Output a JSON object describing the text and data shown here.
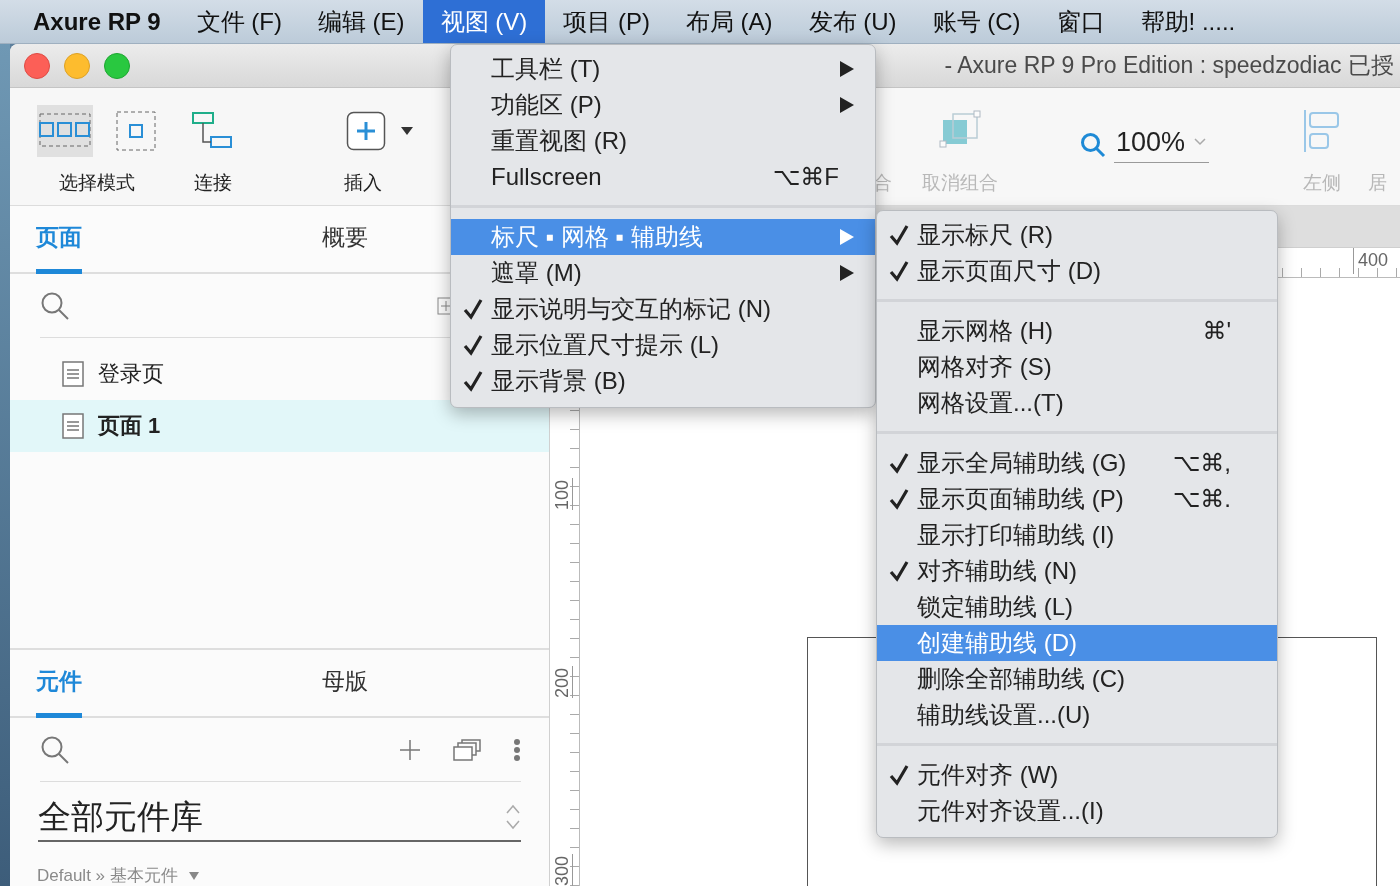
{
  "menubar": {
    "app_name": "Axure RP 9",
    "items": [
      {
        "label": "文件 (F)",
        "selected": false
      },
      {
        "label": "编辑 (E)",
        "selected": false
      },
      {
        "label": "视图 (V)",
        "selected": true
      },
      {
        "label": "项目 (P)",
        "selected": false
      },
      {
        "label": "布局 (A)",
        "selected": false
      },
      {
        "label": "发布 (U)",
        "selected": false
      },
      {
        "label": "账号 (C)",
        "selected": false
      },
      {
        "label": "窗口",
        "selected": false
      },
      {
        "label": "帮助! .....",
        "selected": false
      }
    ]
  },
  "window": {
    "title": "- Axure RP 9 Pro Edition : speedzodiac 已授"
  },
  "toolbar": {
    "items": [
      {
        "kind": "select",
        "label": "选择模式",
        "disabled": false,
        "modes": [
          {
            "kind": "intersect",
            "selected": true
          },
          {
            "kind": "contain",
            "selected": false
          }
        ]
      },
      {
        "kind": "connect",
        "label": "连接",
        "disabled": false
      },
      {
        "kind": "insert",
        "label": "插入",
        "disabled": false
      },
      {
        "kind": "group",
        "label": "合",
        "disabled": true
      },
      {
        "kind": "ungroup",
        "label": "取消组合",
        "disabled": true
      },
      {
        "kind": "zoom",
        "label": "100%",
        "disabled": false
      },
      {
        "kind": "align",
        "label": "左侧",
        "disabled": true
      },
      {
        "kind": "center",
        "label": "居",
        "disabled": true
      }
    ]
  },
  "pages_panel": {
    "tabs": [
      {
        "label": "页面",
        "selected": true
      },
      {
        "label": "概要",
        "selected": false
      }
    ],
    "pages": [
      {
        "label": "登录页",
        "selected": false
      },
      {
        "label": "页面 1",
        "selected": true
      }
    ]
  },
  "widgets_panel": {
    "tabs": [
      {
        "label": "元件",
        "selected": true
      },
      {
        "label": "母版",
        "selected": false
      }
    ],
    "library": "全部元件库",
    "breadcrumb": "Default » 基本元件"
  },
  "canvas": {
    "top_ruler_labels": [
      "400"
    ],
    "side_ruler_labels": [
      "100",
      "200",
      "300"
    ]
  },
  "view_menu": {
    "items": [
      {
        "kind": "item",
        "label": "工具栏 (T)",
        "submenu": true,
        "checked": false,
        "selected": false
      },
      {
        "kind": "item",
        "label": "功能区 (P)",
        "submenu": true,
        "checked": false,
        "selected": false
      },
      {
        "kind": "item",
        "label": "重置视图 (R)",
        "submenu": false,
        "checked": false,
        "selected": false
      },
      {
        "kind": "item",
        "label": "Fullscreen",
        "shortcut": "⌥⌘F",
        "submenu": false,
        "checked": false,
        "selected": false
      },
      {
        "kind": "separator"
      },
      {
        "kind": "item",
        "label": "标尺 ▪ 网格 ▪ 辅助线",
        "submenu": true,
        "checked": false,
        "selected": true
      },
      {
        "kind": "item",
        "label": "遮罩 (M)",
        "submenu": true,
        "checked": false,
        "selected": false
      },
      {
        "kind": "item",
        "label": "显示说明与交互的标记 (N)",
        "submenu": false,
        "checked": true,
        "selected": false
      },
      {
        "kind": "item",
        "label": "显示位置尺寸提示 (L)",
        "submenu": false,
        "checked": true,
        "selected": false
      },
      {
        "kind": "item",
        "label": "显示背景 (B)",
        "submenu": false,
        "checked": true,
        "selected": false
      }
    ]
  },
  "guides_submenu": {
    "items": [
      {
        "kind": "item",
        "label": "显示标尺 (R)",
        "submenu": false,
        "checked": true,
        "selected": false
      },
      {
        "kind": "item",
        "label": "显示页面尺寸 (D)",
        "submenu": false,
        "checked": true,
        "selected": false
      },
      {
        "kind": "separator"
      },
      {
        "kind": "item",
        "label": "显示网格 (H)",
        "shortcut": "⌘'",
        "submenu": false,
        "checked": false,
        "selected": false
      },
      {
        "kind": "item",
        "label": "网格对齐 (S)",
        "submenu": false,
        "checked": false,
        "selected": false
      },
      {
        "kind": "item",
        "label": "网格设置...(T)",
        "submenu": false,
        "checked": false,
        "selected": false
      },
      {
        "kind": "separator"
      },
      {
        "kind": "item",
        "label": "显示全局辅助线 (G)",
        "shortcut": "⌥⌘,",
        "submenu": false,
        "checked": true,
        "selected": false
      },
      {
        "kind": "item",
        "label": "显示页面辅助线 (P)",
        "shortcut": "⌥⌘.",
        "submenu": false,
        "checked": true,
        "selected": false
      },
      {
        "kind": "item",
        "label": "显示打印辅助线 (I)",
        "submenu": false,
        "checked": false,
        "selected": false
      },
      {
        "kind": "item",
        "label": "对齐辅助线 (N)",
        "submenu": false,
        "checked": true,
        "selected": false
      },
      {
        "kind": "item",
        "label": "锁定辅助线 (L)",
        "submenu": false,
        "checked": false,
        "selected": false
      },
      {
        "kind": "item",
        "label": "创建辅助线 (D)",
        "submenu": false,
        "checked": false,
        "selected": true
      },
      {
        "kind": "item",
        "label": "删除全部辅助线 (C)",
        "submenu": false,
        "checked": false,
        "selected": false
      },
      {
        "kind": "item",
        "label": "辅助线设置...(U)",
        "submenu": false,
        "checked": false,
        "selected": false
      },
      {
        "kind": "separator"
      },
      {
        "kind": "item",
        "label": "元件对齐 (W)",
        "submenu": false,
        "checked": true,
        "selected": false
      },
      {
        "kind": "item",
        "label": "元件对齐设置...(I)",
        "submenu": false,
        "checked": false,
        "selected": false
      }
    ]
  }
}
